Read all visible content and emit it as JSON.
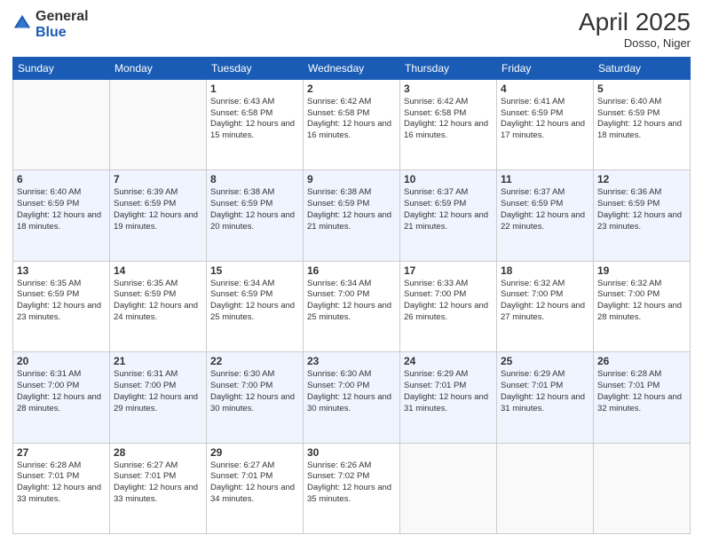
{
  "logo": {
    "general": "General",
    "blue": "Blue"
  },
  "title": "April 2025",
  "location": "Dosso, Niger",
  "days_of_week": [
    "Sunday",
    "Monday",
    "Tuesday",
    "Wednesday",
    "Thursday",
    "Friday",
    "Saturday"
  ],
  "weeks": [
    [
      {
        "day": "",
        "empty": true
      },
      {
        "day": "",
        "empty": true
      },
      {
        "day": "1",
        "sunrise": "6:43 AM",
        "sunset": "6:58 PM",
        "daylight": "12 hours and 15 minutes."
      },
      {
        "day": "2",
        "sunrise": "6:42 AM",
        "sunset": "6:58 PM",
        "daylight": "12 hours and 16 minutes."
      },
      {
        "day": "3",
        "sunrise": "6:42 AM",
        "sunset": "6:58 PM",
        "daylight": "12 hours and 16 minutes."
      },
      {
        "day": "4",
        "sunrise": "6:41 AM",
        "sunset": "6:59 PM",
        "daylight": "12 hours and 17 minutes."
      },
      {
        "day": "5",
        "sunrise": "6:40 AM",
        "sunset": "6:59 PM",
        "daylight": "12 hours and 18 minutes."
      }
    ],
    [
      {
        "day": "6",
        "sunrise": "6:40 AM",
        "sunset": "6:59 PM",
        "daylight": "12 hours and 18 minutes."
      },
      {
        "day": "7",
        "sunrise": "6:39 AM",
        "sunset": "6:59 PM",
        "daylight": "12 hours and 19 minutes."
      },
      {
        "day": "8",
        "sunrise": "6:38 AM",
        "sunset": "6:59 PM",
        "daylight": "12 hours and 20 minutes."
      },
      {
        "day": "9",
        "sunrise": "6:38 AM",
        "sunset": "6:59 PM",
        "daylight": "12 hours and 21 minutes."
      },
      {
        "day": "10",
        "sunrise": "6:37 AM",
        "sunset": "6:59 PM",
        "daylight": "12 hours and 21 minutes."
      },
      {
        "day": "11",
        "sunrise": "6:37 AM",
        "sunset": "6:59 PM",
        "daylight": "12 hours and 22 minutes."
      },
      {
        "day": "12",
        "sunrise": "6:36 AM",
        "sunset": "6:59 PM",
        "daylight": "12 hours and 23 minutes."
      }
    ],
    [
      {
        "day": "13",
        "sunrise": "6:35 AM",
        "sunset": "6:59 PM",
        "daylight": "12 hours and 23 minutes."
      },
      {
        "day": "14",
        "sunrise": "6:35 AM",
        "sunset": "6:59 PM",
        "daylight": "12 hours and 24 minutes."
      },
      {
        "day": "15",
        "sunrise": "6:34 AM",
        "sunset": "6:59 PM",
        "daylight": "12 hours and 25 minutes."
      },
      {
        "day": "16",
        "sunrise": "6:34 AM",
        "sunset": "7:00 PM",
        "daylight": "12 hours and 25 minutes."
      },
      {
        "day": "17",
        "sunrise": "6:33 AM",
        "sunset": "7:00 PM",
        "daylight": "12 hours and 26 minutes."
      },
      {
        "day": "18",
        "sunrise": "6:32 AM",
        "sunset": "7:00 PM",
        "daylight": "12 hours and 27 minutes."
      },
      {
        "day": "19",
        "sunrise": "6:32 AM",
        "sunset": "7:00 PM",
        "daylight": "12 hours and 28 minutes."
      }
    ],
    [
      {
        "day": "20",
        "sunrise": "6:31 AM",
        "sunset": "7:00 PM",
        "daylight": "12 hours and 28 minutes."
      },
      {
        "day": "21",
        "sunrise": "6:31 AM",
        "sunset": "7:00 PM",
        "daylight": "12 hours and 29 minutes."
      },
      {
        "day": "22",
        "sunrise": "6:30 AM",
        "sunset": "7:00 PM",
        "daylight": "12 hours and 30 minutes."
      },
      {
        "day": "23",
        "sunrise": "6:30 AM",
        "sunset": "7:00 PM",
        "daylight": "12 hours and 30 minutes."
      },
      {
        "day": "24",
        "sunrise": "6:29 AM",
        "sunset": "7:01 PM",
        "daylight": "12 hours and 31 minutes."
      },
      {
        "day": "25",
        "sunrise": "6:29 AM",
        "sunset": "7:01 PM",
        "daylight": "12 hours and 31 minutes."
      },
      {
        "day": "26",
        "sunrise": "6:28 AM",
        "sunset": "7:01 PM",
        "daylight": "12 hours and 32 minutes."
      }
    ],
    [
      {
        "day": "27",
        "sunrise": "6:28 AM",
        "sunset": "7:01 PM",
        "daylight": "12 hours and 33 minutes."
      },
      {
        "day": "28",
        "sunrise": "6:27 AM",
        "sunset": "7:01 PM",
        "daylight": "12 hours and 33 minutes."
      },
      {
        "day": "29",
        "sunrise": "6:27 AM",
        "sunset": "7:01 PM",
        "daylight": "12 hours and 34 minutes."
      },
      {
        "day": "30",
        "sunrise": "6:26 AM",
        "sunset": "7:02 PM",
        "daylight": "12 hours and 35 minutes."
      },
      {
        "day": "",
        "empty": true
      },
      {
        "day": "",
        "empty": true
      },
      {
        "day": "",
        "empty": true
      }
    ]
  ]
}
